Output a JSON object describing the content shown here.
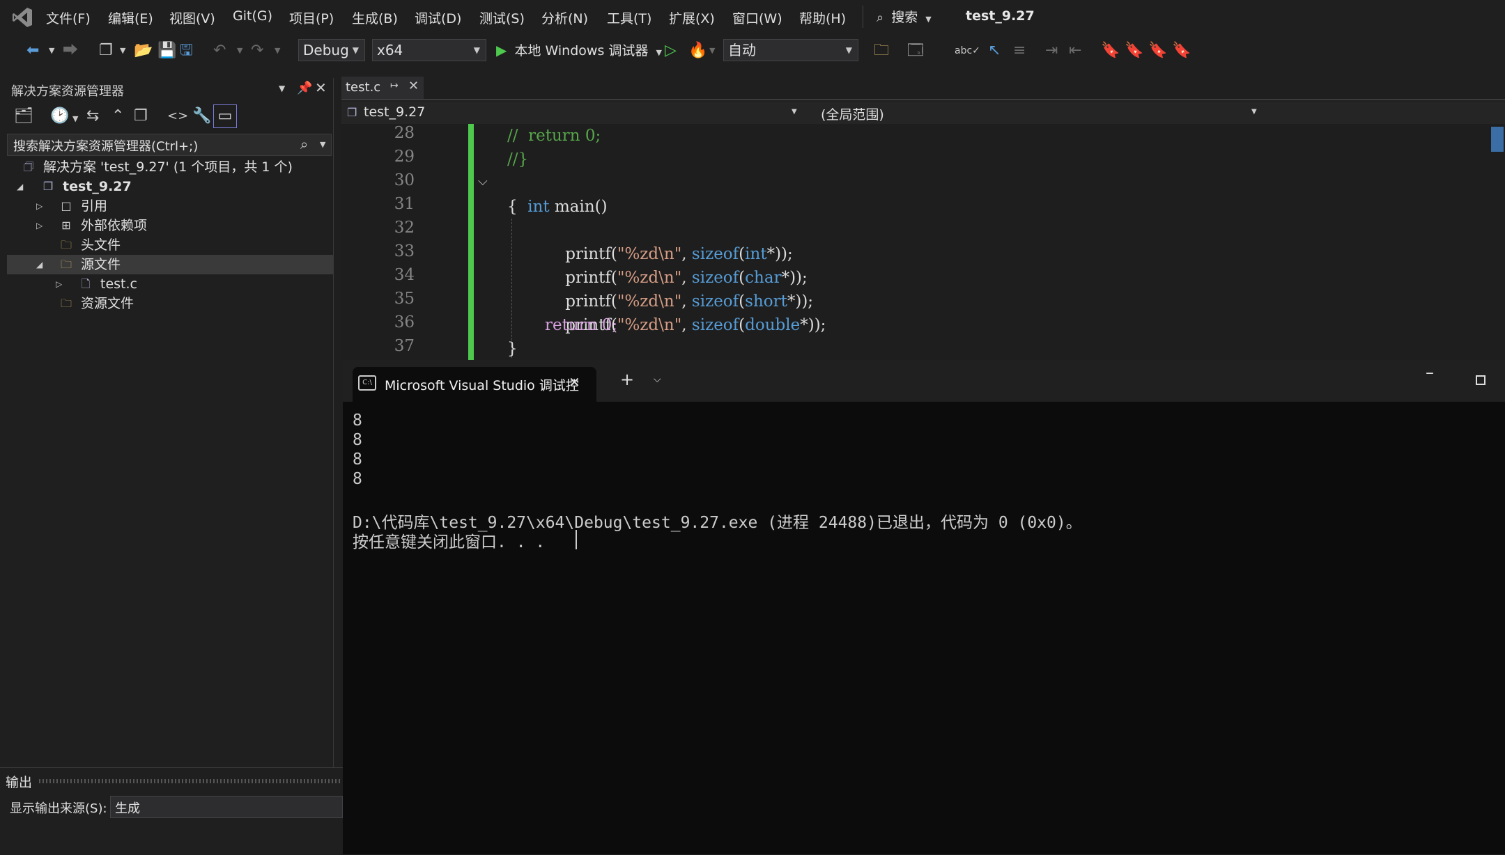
{
  "menu": {
    "items": [
      "文件(F)",
      "编辑(E)",
      "视图(V)",
      "Git(G)",
      "项目(P)",
      "生成(B)",
      "调试(D)",
      "测试(S)",
      "分析(N)",
      "工具(T)",
      "扩展(X)",
      "窗口(W)",
      "帮助(H)"
    ],
    "search_label": "搜索",
    "window_title": "test_9.27"
  },
  "toolbar": {
    "config": "Debug",
    "platform": "x64",
    "run_label": "本地 Windows 调试器",
    "auto": "自动"
  },
  "solution_explorer": {
    "title": "解决方案资源管理器",
    "search_placeholder": "搜索解决方案资源管理器(Ctrl+;)",
    "solution": "解决方案 'test_9.27' (1 个项目，共 1 个)",
    "project": "test_9.27",
    "items": {
      "references": "引用",
      "external": "外部依赖项",
      "headers": "头文件",
      "sources": "源文件",
      "file": "test.c",
      "resources": "资源文件"
    }
  },
  "editor": {
    "tab": "test.c",
    "scope_left": "test_9.27",
    "scope_right": "(全局范围)",
    "lines": [
      {
        "n": "28",
        "code": "//  return 0;"
      },
      {
        "n": "29",
        "code": "//}"
      },
      {
        "n": "30",
        "code": "int main()"
      },
      {
        "n": "31",
        "code": "{"
      },
      {
        "n": "32",
        "code": "printf(\"%zd\\n\", sizeof(int*));"
      },
      {
        "n": "33",
        "code": "printf(\"%zd\\n\", sizeof(char*));"
      },
      {
        "n": "34",
        "code": "printf(\"%zd\\n\", sizeof(short*));"
      },
      {
        "n": "35",
        "code": "printf(\"%zd\\n\", sizeof(double*));"
      },
      {
        "n": "36",
        "code": "return 0;"
      },
      {
        "n": "37",
        "code": "}"
      }
    ]
  },
  "console": {
    "tab_title": "Microsoft Visual Studio 调试控",
    "lines": [
      "8",
      "8",
      "8",
      "8",
      "",
      "D:\\代码库\\test_9.27\\x64\\Debug\\test_9.27.exe (进程 24488)已退出，代码为 0 (0x0)。",
      "按任意键关闭此窗口. . ."
    ]
  },
  "output": {
    "title": "输出",
    "source_label": "显示输出来源(S):",
    "source_value": "生成"
  },
  "colors": {
    "keyword": "#569cd6",
    "comment": "#57a64a",
    "string": "#d69d85",
    "func": "#dcdcdc",
    "control": "#d8a0df",
    "accent_green": "#4ec94e"
  }
}
